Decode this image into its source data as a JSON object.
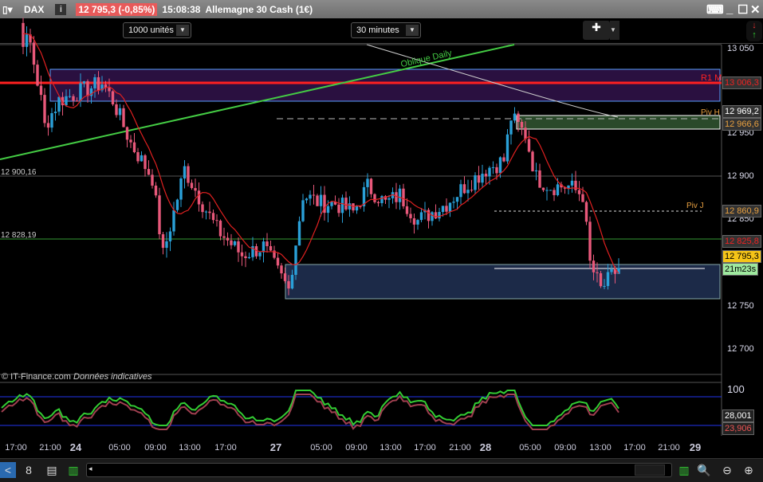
{
  "title": {
    "symbol": "DAX",
    "price": "12 795,3 (-0,85%)",
    "time": "15:08:38",
    "instrument": "Allemagne 30 Cash (1€)"
  },
  "toolbar": {
    "quantity": "1000 unités",
    "timeframe": "30 minutes"
  },
  "price_axis": {
    "ticks": [
      "13 050",
      "12 950",
      "12 900",
      "12 850",
      "12 750",
      "12 700"
    ]
  },
  "tags": {
    "r1": "13 006,3",
    "pivh1": "12 969,2",
    "pivh2": "12 966,6",
    "pivj": "12 860,9",
    "ma": "12 825,8",
    "last": "12 795,3",
    "countdown": "21m23s"
  },
  "labels": {
    "r1": "R1 M",
    "pivh": "Piv H",
    "pivj": "Piv J",
    "oblique": "Oblique Daily",
    "lvl1": "12 900,16",
    "lvl2": "12 828,19",
    "source": "© IT-Finance.com",
    "source_note": "Données indicatives"
  },
  "oscillator": {
    "top": "100",
    "v1": "28,001",
    "v2": "23,906"
  },
  "time_axis": [
    "17:00",
    "21:00",
    "24",
    "05:00",
    "09:00",
    "13:00",
    "17:00",
    "27",
    "05:00",
    "09:00",
    "13:00",
    "17:00",
    "21:00",
    "28",
    "05:00",
    "09:00",
    "13:00",
    "17:00",
    "21:00",
    "29"
  ],
  "chart_data": {
    "type": "candlestick",
    "ylim": [
      12700,
      13060
    ],
    "key_prices": [
      [
        0,
        13080
      ],
      [
        8,
        13055
      ],
      [
        11,
        12990
      ],
      [
        12,
        12960
      ],
      [
        16,
        12990
      ],
      [
        22,
        13000
      ],
      [
        28,
        13010
      ],
      [
        31,
        12990
      ],
      [
        36,
        12940
      ],
      [
        42,
        12900
      ],
      [
        45,
        12810
      ],
      [
        48,
        12860
      ],
      [
        51,
        12910
      ],
      [
        56,
        12870
      ],
      [
        60,
        12840
      ],
      [
        67,
        12810
      ],
      [
        73,
        12820
      ],
      [
        77,
        12790
      ],
      [
        80,
        12770
      ],
      [
        84,
        12880
      ],
      [
        89,
        12870
      ],
      [
        93,
        12870
      ],
      [
        98,
        12860
      ],
      [
        102,
        12890
      ],
      [
        107,
        12870
      ],
      [
        111,
        12880
      ],
      [
        116,
        12850
      ],
      [
        120,
        12860
      ],
      [
        124,
        12870
      ],
      [
        129,
        12890
      ],
      [
        135,
        12910
      ],
      [
        140,
        12920
      ],
      [
        142,
        12970
      ],
      [
        146,
        12950
      ],
      [
        149,
        12900
      ],
      [
        153,
        12890
      ],
      [
        158,
        12890
      ],
      [
        162,
        12880
      ],
      [
        164,
        12800
      ],
      [
        167,
        12770
      ],
      [
        169,
        12780
      ],
      [
        172,
        12795
      ]
    ]
  },
  "colors": {
    "up": "#2aa0d8",
    "down": "#e8587a",
    "ma": "#e02020",
    "r1": "#ff2020",
    "oblique": "#44cc44"
  }
}
